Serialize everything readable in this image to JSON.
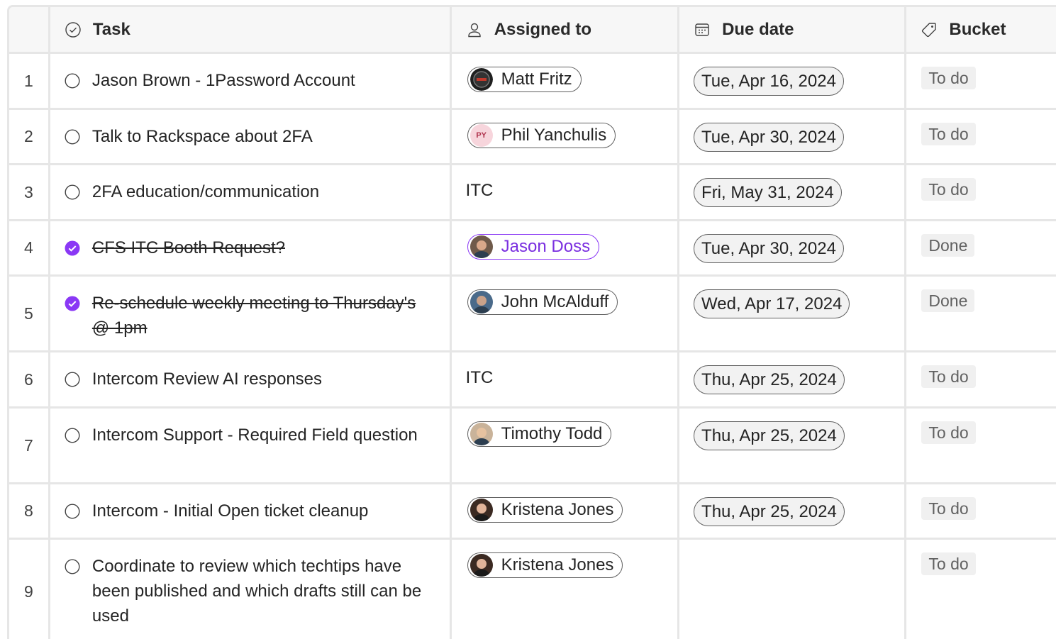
{
  "columns": {
    "task": "Task",
    "assigned": "Assigned to",
    "due": "Due date",
    "bucket": "Bucket"
  },
  "rows": [
    {
      "num": "1",
      "task": "Jason Brown - 1Password Account",
      "done": false,
      "assignee": "Matt Fritz",
      "due": "Tue, Apr 16, 2024",
      "bucket": "To do"
    },
    {
      "num": "2",
      "task": "Talk to Rackspace about 2FA",
      "done": false,
      "assignee": "Phil Yanchulis",
      "initials": "PY",
      "due": "Tue, Apr 30, 2024",
      "bucket": "To do"
    },
    {
      "num": "3",
      "task": "2FA education/communication",
      "done": false,
      "assignee_text": "ITC",
      "due": "Fri, May 31, 2024",
      "bucket": "To do"
    },
    {
      "num": "4",
      "task": "CFS ITC Booth Request?",
      "done": true,
      "assignee": "Jason Doss",
      "due": "Tue, Apr 30, 2024",
      "bucket": "Done"
    },
    {
      "num": "5",
      "task": "Re-schedule weekly meeting to Thursday's @ 1pm",
      "done": true,
      "assignee": "John McAlduff",
      "due": "Wed, Apr 17, 2024",
      "bucket": "Done"
    },
    {
      "num": "6",
      "task": "Intercom Review AI responses",
      "done": false,
      "assignee_text": "ITC",
      "due": "Thu, Apr 25, 2024",
      "bucket": "To do"
    },
    {
      "num": "7",
      "task": "Intercom Support - Required Field question",
      "done": false,
      "assignee": "Timothy Todd",
      "due": "Thu, Apr 25, 2024",
      "bucket": "To do"
    },
    {
      "num": "8",
      "task": "Intercom - Initial Open ticket cleanup",
      "done": false,
      "assignee": "Kristena Jones",
      "due": "Thu, Apr 25, 2024",
      "bucket": "To do"
    },
    {
      "num": "9",
      "task": "Coordinate to review which techtips have been published and which drafts still can be used",
      "done": false,
      "assignee": "Kristena Jones",
      "due": "",
      "bucket": "To do"
    }
  ],
  "colors": {
    "accent": "#8a38f5",
    "grid_line": "#e6e6e6",
    "header_bg": "#f7f7f7",
    "bucket_bg": "#f0f0f0"
  }
}
